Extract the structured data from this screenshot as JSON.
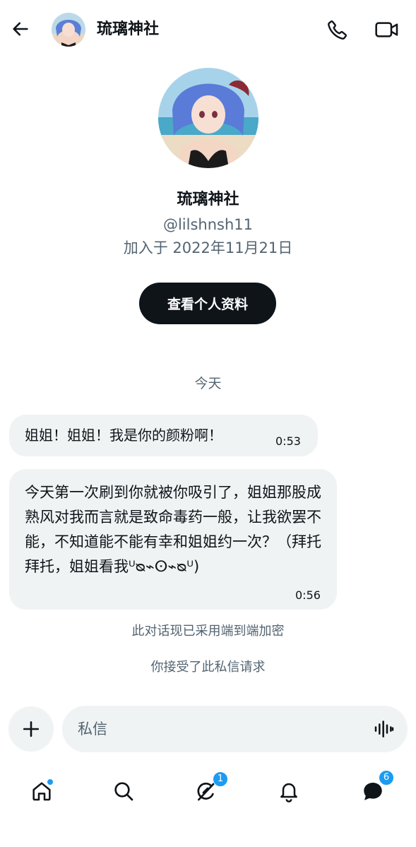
{
  "header": {
    "back_icon": "arrow-left-icon",
    "title": "琉璃神社",
    "call_icon": "phone-icon",
    "video_icon": "video-camera-icon"
  },
  "profile": {
    "name": "琉璃神社",
    "handle": "@lilshnsh11",
    "joined": "加入于 2022年11月21日",
    "view_profile_label": "查看个人资料"
  },
  "conversation": {
    "date_separator": "今天",
    "messages": [
      {
        "text": "姐姐！姐姐！我是你的颜粉啊！",
        "time": "0:53"
      },
      {
        "text": "今天第一次刷到你就被你吸引了，姐姐那股成熟风对我而言就是致命毒药一般，让我欲罢不能，不知道能不能有幸和姐姐约一次？（拜托拜托，姐姐看我ᵁᴓ⌁ⵙ⌁ᴓᵁ)",
        "time": "0:56"
      }
    ],
    "encryption_notice": "此对话现已采用端到端加密",
    "request_notice": "你接受了此私信请求"
  },
  "composer": {
    "plus_icon": "plus-icon",
    "placeholder": "私信",
    "voice_icon": "voice-waveform-icon"
  },
  "nav": {
    "items": [
      {
        "icon": "home-icon",
        "indicator": "dot"
      },
      {
        "icon": "search-icon"
      },
      {
        "icon": "grok-icon",
        "badge": "1"
      },
      {
        "icon": "bell-icon"
      },
      {
        "icon": "messages-icon",
        "badge": "6"
      }
    ]
  },
  "colors": {
    "accent": "#1d9bf0",
    "text_primary": "#0f1419",
    "text_secondary": "#536471",
    "bubble_bg": "#eff3f4"
  }
}
